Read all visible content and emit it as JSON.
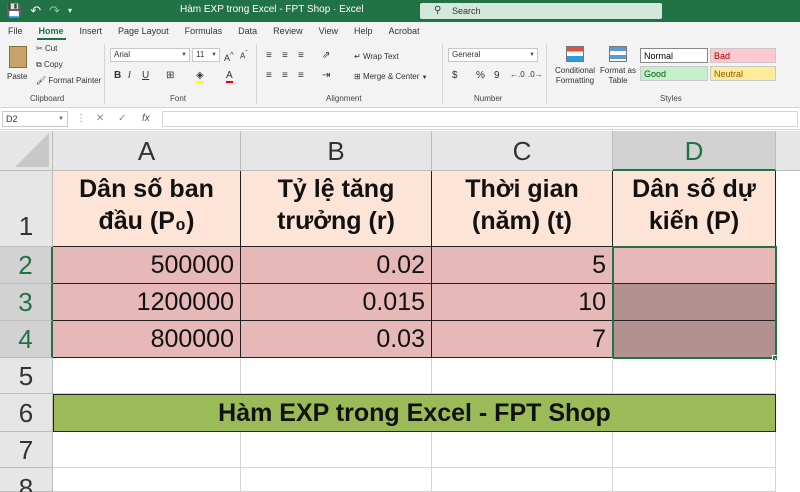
{
  "window": {
    "title": "Hàm EXP trong Excel - FPT Shop  ·  Excel",
    "search_placeholder": "Search"
  },
  "quick_access": {
    "save_icon": "save-icon",
    "undo_icon": "undo-icon",
    "redo_icon": "redo-icon"
  },
  "ribbon_tabs": [
    "File",
    "Home",
    "Insert",
    "Page Layout",
    "Formulas",
    "Data",
    "Review",
    "View",
    "Help",
    "Acrobat"
  ],
  "ribbon": {
    "clipboard": {
      "paste": "Paste",
      "cut": "Cut",
      "copy": "Copy",
      "format_painter": "Format Painter",
      "label": "Clipboard"
    },
    "font": {
      "name": "Arial",
      "size": "11",
      "label": "Font",
      "bold": "B",
      "italic": "I",
      "underline": "U"
    },
    "alignment": {
      "wrap_text": "Wrap Text",
      "merge_center": "Merge & Center",
      "label": "Alignment"
    },
    "number": {
      "format": "General",
      "currency": "$",
      "percent": "%",
      "comma": "9",
      "label": "Number"
    },
    "styles": {
      "conditional_formatting": "Conditional Formatting",
      "format_as_table": "Format as Table",
      "normal": "Normal",
      "bad": "Bad",
      "good": "Good",
      "neutral": "Neutral",
      "label": "Styles"
    }
  },
  "formula_bar": {
    "name_box": "D2",
    "fx": "fx",
    "formula": ""
  },
  "grid": {
    "columns": [
      "A",
      "B",
      "C",
      "D"
    ],
    "rows": [
      "1",
      "2",
      "3",
      "4",
      "5",
      "6",
      "7",
      "8"
    ],
    "header": {
      "a": [
        "Dân số ban",
        "đầu (P₀)"
      ],
      "b": [
        "Tỷ lệ tăng",
        "trưởng (r)"
      ],
      "c": [
        "Thời gian",
        "(năm) (t)"
      ],
      "d": [
        "Dân số dự",
        "kiến (P)"
      ]
    },
    "data": [
      {
        "a": "500000",
        "b": "0.02",
        "c": "5",
        "d": ""
      },
      {
        "a": "1200000",
        "b": "0.015",
        "c": "10",
        "d": ""
      },
      {
        "a": "800000",
        "b": "0.03",
        "c": "7",
        "d": ""
      }
    ],
    "banner": "Hàm EXP trong Excel - FPT Shop"
  },
  "colors": {
    "excel_green": "#217346",
    "header_fill": "#fce4d6",
    "data_fill": "#e6b8b7",
    "banner_fill": "#9bbb59"
  }
}
